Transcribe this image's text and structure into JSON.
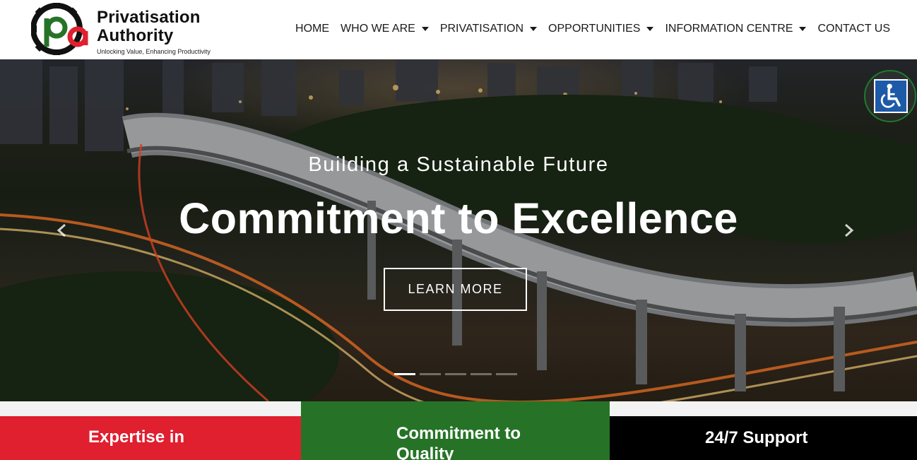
{
  "brand": {
    "name": "Privatisation Authority",
    "tagline": "Unlocking Value, Enhancing Productivity",
    "colors": {
      "green": "#267328",
      "red": "#e01f2f",
      "black": "#000000"
    }
  },
  "nav": {
    "items": [
      {
        "label": "HOME",
        "dropdown": false
      },
      {
        "label": "WHO WE ARE",
        "dropdown": true
      },
      {
        "label": "PRIVATISATION",
        "dropdown": true
      },
      {
        "label": "OPPORTUNITIES",
        "dropdown": true
      },
      {
        "label": "INFORMATION CENTRE",
        "dropdown": true
      },
      {
        "label": "CONTACT US",
        "dropdown": false
      }
    ]
  },
  "hero": {
    "subtitle": "Building a Sustainable Future",
    "title": "Commitment to Excellence",
    "button_label": "LEARN MORE",
    "prev_icon": "chevron-left-icon",
    "next_icon": "chevron-right-icon",
    "slides_total": 5,
    "active_slide": 1
  },
  "accessibility": {
    "icon": "wheelchair-icon"
  },
  "features": [
    {
      "title": "Expertise in",
      "color": "#e01f2f"
    },
    {
      "title": "Commitment to Quality",
      "color": "#267328"
    },
    {
      "title": "24/7 Support",
      "color": "#000000"
    }
  ]
}
